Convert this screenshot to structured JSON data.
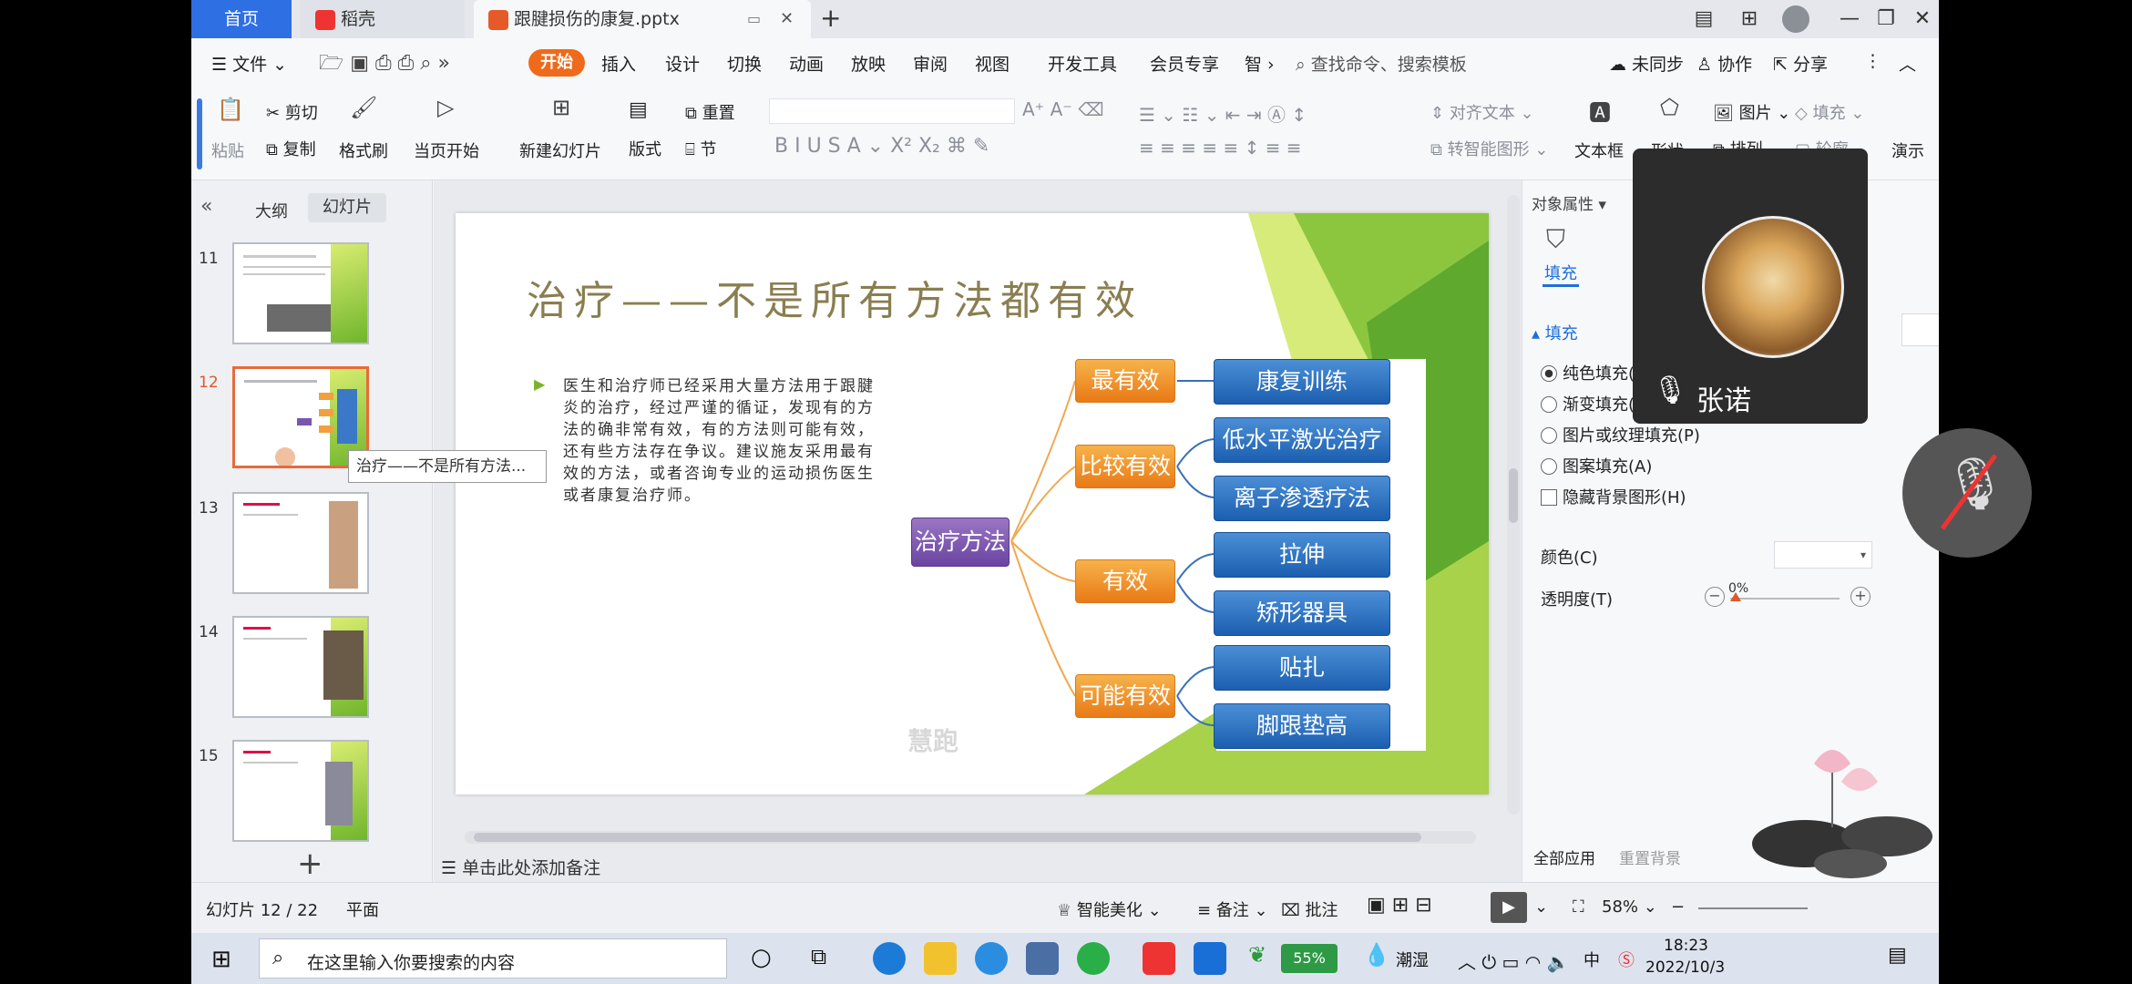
{
  "tabs": {
    "home": "首页",
    "daoke": "稻壳",
    "doc": "跟腱损伤的康复.pptx",
    "add": "+"
  },
  "menu": {
    "file": "文件",
    "items": [
      "开始",
      "插入",
      "设计",
      "切换",
      "动画",
      "放映",
      "审阅",
      "视图",
      "开发工具",
      "会员专享",
      "智"
    ],
    "search": "查找命令、搜索模板",
    "unsynced": "未同步",
    "collab": "协作",
    "share": "分享"
  },
  "ribbon": {
    "paste": "粘贴",
    "cut": "剪切",
    "copy": "复制",
    "format_painter": "格式刷",
    "from_current": "当页开始",
    "new_slide": "新建幻灯片",
    "layout": "版式",
    "section": "节",
    "reset": "重置",
    "align_text": "对齐文本",
    "smart_shape": "转智能图形",
    "textbox": "文本框",
    "shape": "形状",
    "arrange": "排列",
    "picture": "图片",
    "fill": "填充",
    "outline": "轮廓",
    "more": "演示"
  },
  "left_panel": {
    "tab_outline": "大纲",
    "tab_slides": "幻灯片",
    "tooltip": "治疗——不是所有方法...",
    "slides": [
      {
        "num": "11"
      },
      {
        "num": "12",
        "selected": true
      },
      {
        "num": "13"
      },
      {
        "num": "14"
      },
      {
        "num": "15"
      }
    ],
    "add": "+"
  },
  "slide": {
    "title": "治疗——不是所有方法都有效",
    "body": "医生和治疗师已经采用大量方法用于跟腱炎的治疗，经过严谨的循证，发现有的方法的确非常有效，有的方法则可能有效，还有些方法存在争议。建议施友采用最有效的方法，或者咨询专业的运动损伤医生或者康复治疗师。",
    "root": "治疗方法",
    "levels": [
      {
        "label": "最有效",
        "items": [
          "康复训练"
        ]
      },
      {
        "label": "比较有效",
        "items": [
          "低水平激光治疗",
          "离子渗透疗法"
        ]
      },
      {
        "label": "有效",
        "items": [
          "拉伸",
          "矫形器具"
        ]
      },
      {
        "label": "可能有效",
        "items": [
          "贴扎",
          "脚跟垫高"
        ]
      }
    ],
    "watermark": "慧跑"
  },
  "notes_placeholder": "单击此处添加备注",
  "right_panel": {
    "header": "对象属性",
    "fill_tab": "填充",
    "fill_section": "填充",
    "options": [
      "纯色填充(S)",
      "渐变填充(G)",
      "图片或纹理填充(P)",
      "图案填充(A)"
    ],
    "hide_bg": "隐藏背景图形(H)",
    "color_label": "颜色(C)",
    "transparency_label": "透明度(T)",
    "transparency_value": "0%",
    "apply_all": "全部应用",
    "reset_bg": "重置背景"
  },
  "status": {
    "slide_info": "幻灯片 12 / 22",
    "theme": "平面",
    "smart_beautify": "智能美化",
    "notes": "备注",
    "comments": "批注",
    "zoom": "58%"
  },
  "video": {
    "name": "张诺"
  },
  "taskbar": {
    "search_placeholder": "在这里输入你要搜索的内容",
    "battery": "55%",
    "weather": "潮湿",
    "ime": "中",
    "time": "18:23",
    "date": "2022/10/3"
  },
  "colors": {
    "accent_blue": "#2f6fe4",
    "start_orange": "#f06a1b",
    "node_orange": "#e87a17",
    "node_blue": "#1c5fb0",
    "node_purple": "#6a44a0",
    "slide_green": "#6db42a"
  }
}
